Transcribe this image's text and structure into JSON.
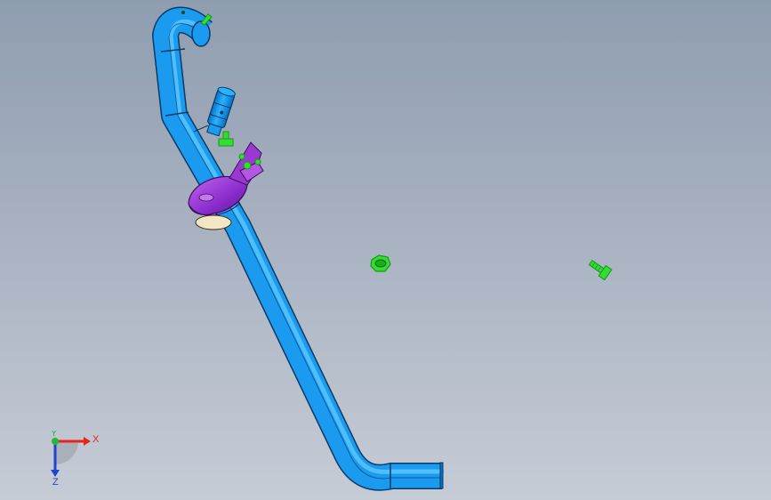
{
  "viewport": {
    "background_top": "#8f9db0",
    "background_bottom": "#c6ccd6"
  },
  "colors": {
    "pipe": "#1a9bef",
    "pipe_dark": "#0b6fc2",
    "pipe_edge": "#0a3a66",
    "clamp": "#a23bd6",
    "clamp_dark": "#6c1f98",
    "hardware": "#33dd33",
    "hardware_dark": "#179917",
    "x_axis": "#e8231a",
    "y_axis": "#22bb33",
    "z_axis": "#2244cc"
  },
  "model": {
    "parts": [
      {
        "name": "pipe-assembly",
        "icon": "bent-pipe"
      },
      {
        "name": "pipe-clamp",
        "icon": "clamp-bracket"
      },
      {
        "name": "sensor-fitting",
        "icon": "cylindrical-fitting"
      },
      {
        "name": "nut",
        "icon": "hex-nut"
      },
      {
        "name": "bolt",
        "icon": "hex-bolt"
      }
    ]
  },
  "triad": {
    "x_label": "X",
    "y_label": "Y",
    "z_label": "Z"
  }
}
